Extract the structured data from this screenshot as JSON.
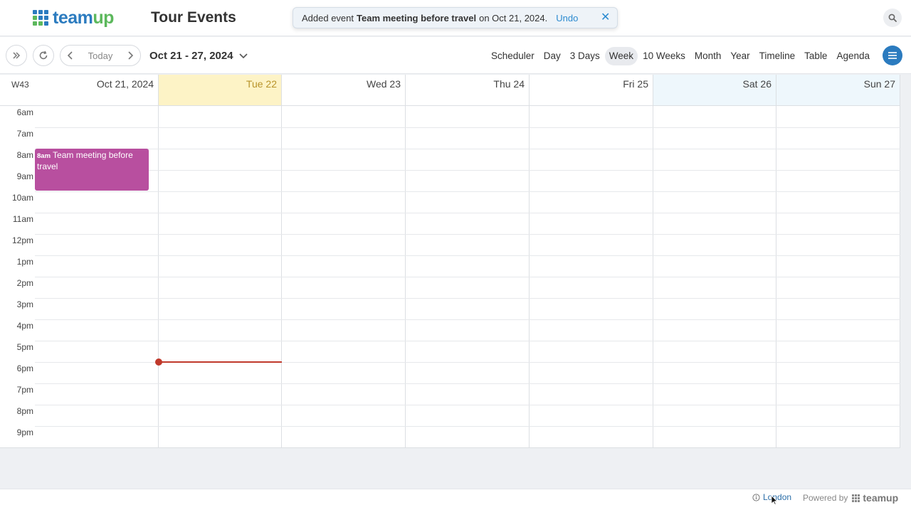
{
  "header": {
    "logo_part1": "team",
    "logo_part2": "up",
    "calendar_title": "Tour Events",
    "toast": {
      "prefix": "Added event",
      "event_name": "Team meeting before travel",
      "suffix": "on Oct 21, 2024.",
      "undo_label": "Undo"
    }
  },
  "toolbar": {
    "today_label": "Today",
    "range_label": "Oct 21 - 27, 2024",
    "views": [
      {
        "label": "Scheduler",
        "active": false
      },
      {
        "label": "Day",
        "active": false
      },
      {
        "label": "3 Days",
        "active": false
      },
      {
        "label": "Week",
        "active": true
      },
      {
        "label": "10 Weeks",
        "active": false
      },
      {
        "label": "Month",
        "active": false
      },
      {
        "label": "Year",
        "active": false
      },
      {
        "label": "Timeline",
        "active": false
      },
      {
        "label": "Table",
        "active": false
      },
      {
        "label": "Agenda",
        "active": false
      }
    ]
  },
  "calendar": {
    "week_number": "W43",
    "days": [
      {
        "label": "Oct 21, 2024",
        "kind": "normal"
      },
      {
        "label": "Tue 22",
        "kind": "today"
      },
      {
        "label": "Wed 23",
        "kind": "normal"
      },
      {
        "label": "Thu 24",
        "kind": "normal"
      },
      {
        "label": "Fri 25",
        "kind": "normal"
      },
      {
        "label": "Sat 26",
        "kind": "weekend"
      },
      {
        "label": "Sun 27",
        "kind": "weekend"
      }
    ],
    "hours": [
      "6am",
      "7am",
      "8am",
      "9am",
      "10am",
      "11am",
      "12pm",
      "1pm",
      "2pm",
      "3pm",
      "4pm",
      "5pm",
      "6pm",
      "7pm",
      "8pm",
      "9pm"
    ],
    "event": {
      "time": "8am",
      "title": "Team meeting before travel",
      "color": "#b84f9f"
    }
  },
  "footer": {
    "timezone": "London",
    "powered_by": "Powered by",
    "brand": "teamup"
  },
  "colors": {
    "accent": "#2b7bbf",
    "brand_green": "#5cb85c",
    "today_bg": "#fdf3c6",
    "now_line": "#c0392b"
  }
}
